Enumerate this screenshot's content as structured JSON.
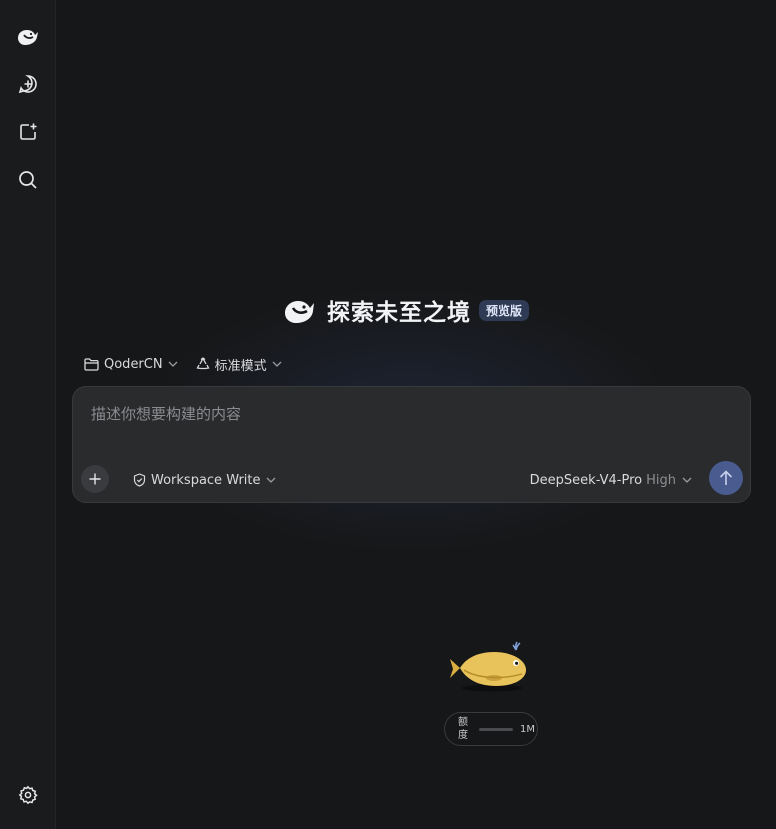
{
  "sidebar": {
    "items": [
      {
        "icon": "whale-logo-icon",
        "label": ""
      },
      {
        "icon": "new-chat-icon",
        "label": ""
      },
      {
        "icon": "new-project-icon",
        "label": ""
      },
      {
        "icon": "search-icon",
        "label": ""
      }
    ],
    "settings_icon": "gear-icon"
  },
  "hero": {
    "title": "探索未至之境",
    "badge": "预览版"
  },
  "context": {
    "project": "QoderCN",
    "mode": "标准模式"
  },
  "composer": {
    "placeholder": "描述你想要构建的内容",
    "value": "",
    "permission": "Workspace Write",
    "model": "DeepSeek-V4-Pro",
    "effort": "High"
  },
  "quota": {
    "label": "额度",
    "value": "1M",
    "used_fraction": 0.0
  },
  "colors": {
    "background": "#161718",
    "sidebar": "#1a1b1c",
    "composer": "#2a2b2d",
    "accent": "#4a5b8f",
    "badge": "#2f3a55",
    "whale_gold": "#e8c25a"
  }
}
